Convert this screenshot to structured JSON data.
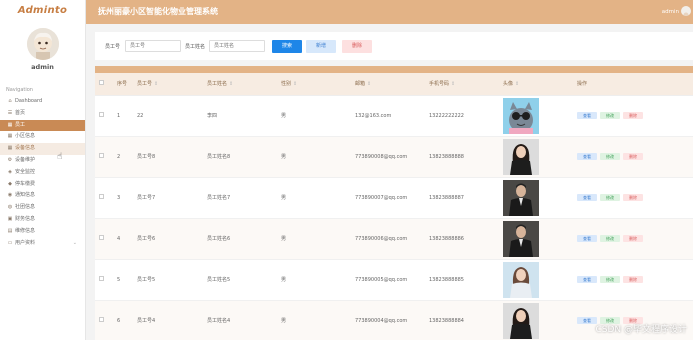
{
  "sidebar": {
    "logo": "Adminto",
    "user": "admin",
    "nav_title": "Navigation",
    "items": [
      {
        "label": "Dashboard",
        "icon": "home-icon",
        "glyph": "⌂",
        "state": ""
      },
      {
        "label": "首页",
        "icon": "list-icon",
        "glyph": "☰",
        "state": ""
      },
      {
        "label": "员工",
        "icon": "grid-icon",
        "glyph": "▦",
        "state": "active"
      },
      {
        "label": "小区信息",
        "icon": "grid-icon",
        "glyph": "▦",
        "state": ""
      },
      {
        "label": "设备信息",
        "icon": "grid-icon",
        "glyph": "▦",
        "state": "sub-active"
      },
      {
        "label": "设备维护",
        "icon": "gear-icon",
        "glyph": "⚙",
        "state": ""
      },
      {
        "label": "安全监控",
        "icon": "shield-icon",
        "glyph": "◈",
        "state": ""
      },
      {
        "label": "停车缴费",
        "icon": "car-icon",
        "glyph": "◆",
        "state": ""
      },
      {
        "label": "通知信息",
        "icon": "bell-icon",
        "glyph": "◉",
        "state": ""
      },
      {
        "label": "社团信息",
        "icon": "people-icon",
        "glyph": "◍",
        "state": ""
      },
      {
        "label": "财务信息",
        "icon": "wallet-icon",
        "glyph": "▣",
        "state": ""
      },
      {
        "label": "维修信息",
        "icon": "wrench-icon",
        "glyph": "▤",
        "state": ""
      },
      {
        "label": "用户资料",
        "icon": "user-icon",
        "glyph": "▭",
        "state": "",
        "chevron": "⌄"
      }
    ]
  },
  "header": {
    "title": "抚州丽豪小区智能化物业管理系统",
    "user": "admin"
  },
  "search": {
    "label_id": "员工号",
    "placeholder_id": "员工号",
    "label_name": "员工姓名",
    "placeholder_name": "员工姓名",
    "btn_search": "搜索",
    "btn_add": "新增",
    "btn_delete": "删除"
  },
  "table": {
    "columns": [
      "序号",
      "员工号",
      "员工姓名",
      "性别",
      "邮箱",
      "手机号码",
      "头像",
      "操作"
    ],
    "actions": {
      "view": "查看",
      "edit": "修改",
      "delete": "删除"
    },
    "rows": [
      {
        "no": "1",
        "id": "22",
        "name": "李四",
        "gender": "男",
        "email": "132@163.com",
        "phone": "13222222222",
        "avatar": "cartoon"
      },
      {
        "no": "2",
        "id": "员工号8",
        "name": "员工姓名8",
        "gender": "男",
        "email": "773890008@qq.com",
        "phone": "13823888888",
        "avatar": "woman"
      },
      {
        "no": "3",
        "id": "员工号7",
        "name": "员工姓名7",
        "gender": "男",
        "email": "773890007@qq.com",
        "phone": "13823888887",
        "avatar": "man"
      },
      {
        "no": "4",
        "id": "员工号6",
        "name": "员工姓名6",
        "gender": "男",
        "email": "773890006@qq.com",
        "phone": "13823888886",
        "avatar": "man"
      },
      {
        "no": "5",
        "id": "员工号5",
        "name": "员工姓名5",
        "gender": "男",
        "email": "773890005@qq.com",
        "phone": "13823888885",
        "avatar": "woman-light"
      },
      {
        "no": "6",
        "id": "员工号4",
        "name": "员工姓名4",
        "gender": "男",
        "email": "773890004@qq.com",
        "phone": "13823888884",
        "avatar": "woman"
      }
    ]
  },
  "watermark": "CSDN @毕文程序设计"
}
